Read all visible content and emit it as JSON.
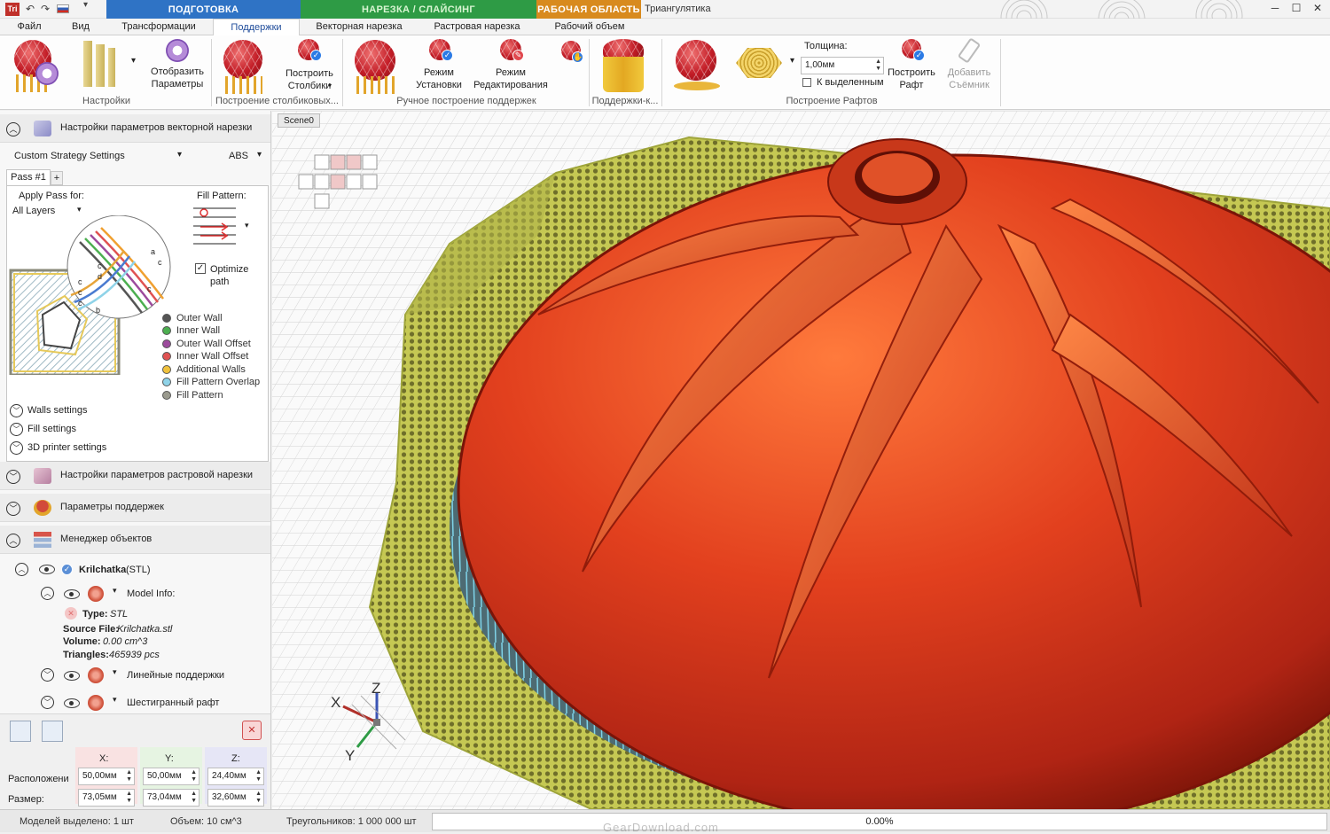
{
  "titlebar": {
    "app_icon": "Tri",
    "window_title": "Триангулятика",
    "context_groups": [
      "ПОДГОТОВКА",
      "НАРЕЗКА / СЛАЙСИНГ",
      "РАБОЧАЯ ОБЛАСТЬ"
    ],
    "context_colors": [
      "#2f73c5",
      "#2e9b45",
      "#d88a1e"
    ]
  },
  "tabs": [
    "Файл",
    "Вид",
    "Трансформации",
    "Поддержки",
    "Векторная нарезка",
    "Растровая нарезка",
    "Рабочий объем"
  ],
  "active_tab": "Поддержки",
  "ribbon": {
    "nastroyki": {
      "button": "Отобразить Параметры",
      "group": "Настройки"
    },
    "columns": {
      "button": "Построить Столбики",
      "arrow": "▾",
      "group": "Построение столбиковых..."
    },
    "manual": {
      "install": "Режим Установки",
      "edit": "Режим Редактирования",
      "group": "Ручное построение поддержек"
    },
    "supports_k": {
      "group": "Поддержки-к..."
    },
    "raft": {
      "thickness_label": "Толщина:",
      "thickness_value": "1,00мм",
      "to_selected": "К выделенным",
      "build_button": "Построить Рафт",
      "add_button": "Добавить Съёмник",
      "group": "Построение Рафтов"
    }
  },
  "left": {
    "vector_header": "Настройки параметров векторной нарезки",
    "strategy": "Custom Strategy Settings",
    "material": "ABS",
    "pass_tab": "Pass #1",
    "add_tab": "+",
    "apply_label": "Apply Pass for:",
    "apply_value": "All Layers",
    "fill_label": "Fill Pattern:",
    "optimize": "Optimize path",
    "legend": [
      {
        "label": "Outer Wall",
        "color": "#555555"
      },
      {
        "label": "Inner Wall",
        "color": "#4caf50"
      },
      {
        "label": "Outer Wall Offset",
        "color": "#9c4a9c"
      },
      {
        "label": "Inner Wall Offset",
        "color": "#e05252"
      },
      {
        "label": "Additional Walls",
        "color": "#f0c23c"
      },
      {
        "label": "Fill Pattern Overlap",
        "color": "#8fd3e8"
      },
      {
        "label": "Fill Pattern",
        "color": "#9a9a8e"
      }
    ],
    "sub_sections": [
      "Walls settings",
      "Fill settings",
      "3D printer settings"
    ],
    "raster_header": "Настройки параметров растровой нарезки",
    "support_header": "Параметры поддержек",
    "objects_header": "Менеджер объектов",
    "object_name": "Krilchatka",
    "object_type_suffix": "(STL)",
    "model_info": "Model Info:",
    "info": {
      "type_label": "Type:",
      "type_value": "STL",
      "source_label": "Source File:",
      "source_value": "Krilchatka.stl",
      "volume_label": "Volume:",
      "volume_value": "0.00 cm^3",
      "triangles_label": "Triangles:",
      "triangles_value": "465939 pcs"
    },
    "linear_supports": "Линейные поддержки",
    "hex_raft": "Шестигранный рафт",
    "coords": {
      "x_label": "X:",
      "y_label": "Y:",
      "z_label": "Z:",
      "position_label": "Расположени",
      "size_label": "Размер:",
      "pos": [
        "50,00мм",
        "50,00мм",
        "24,40мм"
      ],
      "size": [
        "73,05мм",
        "73,04мм",
        "32,60мм"
      ]
    }
  },
  "viewport": {
    "scene_tab": "Scene0",
    "axis_x": "X",
    "axis_y": "Y",
    "axis_z": "Z"
  },
  "status": {
    "selected": "Моделей выделено: 1 шт",
    "volume": "Объем: 10 см^3",
    "triangles": "Треугольников: 1 000 000 шт",
    "progress": "0.00%",
    "progress_value": 0,
    "watermark": "GearDownload.com"
  }
}
